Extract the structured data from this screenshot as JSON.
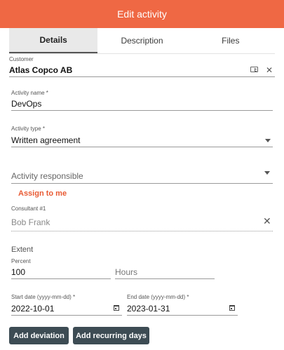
{
  "header": {
    "title": "Edit activity"
  },
  "tabs": [
    {
      "label": "Details",
      "active": true
    },
    {
      "label": "Description",
      "active": false
    },
    {
      "label": "Files",
      "active": false
    }
  ],
  "customer": {
    "label": "Customer",
    "value": "Atlas Copco AB",
    "card_icon": "contact-card-icon",
    "clear_icon": "close-icon"
  },
  "activity_name": {
    "label": "Activity name *",
    "value": "DevOps"
  },
  "activity_type": {
    "label": "Activity type *",
    "value": "Written agreement"
  },
  "activity_responsible": {
    "placeholder": "Activity responsible"
  },
  "assign_to_me": {
    "label": "Assign to me",
    "color": "#e85a33"
  },
  "consultant": {
    "label": "Consultant #1",
    "value": "Bob Frank"
  },
  "extent": {
    "title": "Extent",
    "percent_label": "Percent",
    "percent_value": "100",
    "hours_placeholder": "Hours"
  },
  "start_date": {
    "label": "Start date (yyyy-mm-dd) *",
    "value": "2022-10-01"
  },
  "end_date": {
    "label": "End date (yyyy-mm-dd) *",
    "value": "2023-01-31"
  },
  "buttons": {
    "add_deviation": "Add deviation",
    "add_recurring_days": "Add recurring days"
  },
  "colors": {
    "header": "#ef6844",
    "button": "#3d4c54"
  }
}
